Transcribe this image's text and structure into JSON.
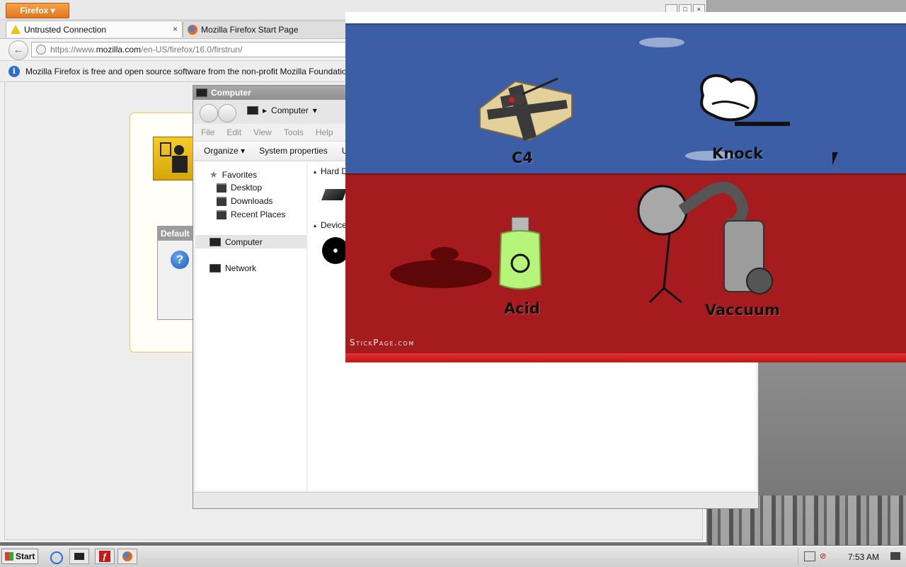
{
  "firefox": {
    "menu_button": "Firefox",
    "tabs": [
      {
        "label": "Untrusted Connection",
        "close": "×"
      },
      {
        "label": "Mozilla Firefox Start Page"
      }
    ],
    "url": {
      "prefix": "https://www.",
      "domain": "mozilla.com",
      "path": "/en-US/firefox/16.0/firstrun/"
    },
    "infobar": "Mozilla Firefox is free and open source software from the non-profit Mozilla Foundation.",
    "dialog_title": "Default",
    "dialog_icon": "?"
  },
  "explorer": {
    "title": "Computer",
    "address": "Computer",
    "menu": [
      "File",
      "Edit",
      "View",
      "Tools",
      "Help"
    ],
    "commands": [
      "Organize",
      "System properties",
      "Uni"
    ],
    "favorites_label": "Favorites",
    "favorites": [
      "Desktop",
      "Downloads",
      "Recent Places"
    ],
    "computer_label": "Computer",
    "network_label": "Network",
    "sections": [
      "Hard Di",
      "Devices"
    ]
  },
  "game": {
    "options": [
      "C4",
      "Knock",
      "Acid",
      "Vaccuum"
    ],
    "credit": "StickPage.com"
  },
  "taskbar": {
    "start": "Start",
    "clock": "7:53 AM"
  },
  "colors": {
    "game_blue": "#3b5ea6",
    "game_red": "#a51b1e",
    "firefox_orange": "#e1761b"
  }
}
